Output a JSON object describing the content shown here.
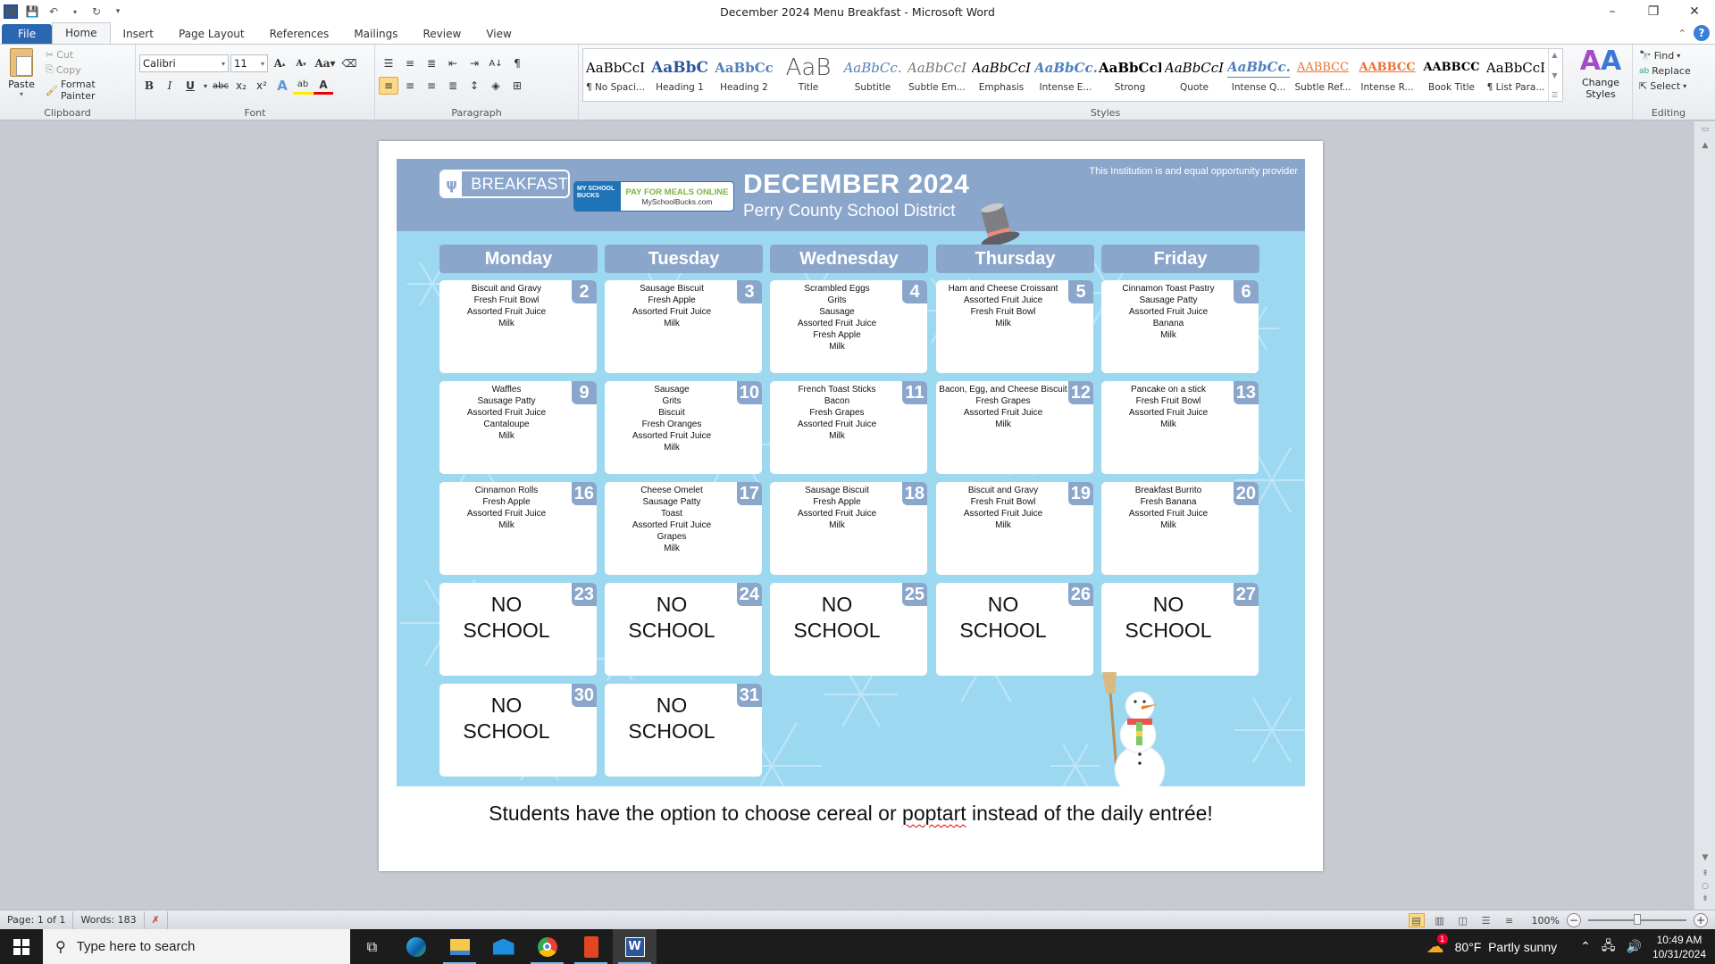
{
  "window": {
    "title": "December 2024 Menu Breakfast  -  Microsoft Word",
    "controls": {
      "minimize": "–",
      "restore": "❐",
      "close": "✕"
    }
  },
  "ribbon_tabs": [
    "File",
    "Home",
    "Insert",
    "Page Layout",
    "References",
    "Mailings",
    "Review",
    "View"
  ],
  "active_tab": "Home",
  "clipboard": {
    "paste": "Paste",
    "cut": "Cut",
    "copy": "Copy",
    "format_painter": "Format Painter",
    "label": "Clipboard"
  },
  "font": {
    "name": "Calibri",
    "size": "11",
    "label": "Font",
    "buttons": [
      "B",
      "I",
      "U",
      "abc",
      "x₂",
      "x²"
    ]
  },
  "paragraph": {
    "label": "Paragraph"
  },
  "styles": {
    "label": "Styles",
    "items": [
      {
        "preview": "AaBbCcI",
        "name": "¶ No Spaci..."
      },
      {
        "preview": "AaBbC",
        "name": "Heading 1"
      },
      {
        "preview": "AaBbCc",
        "name": "Heading 2"
      },
      {
        "preview": "AaB",
        "name": "Title"
      },
      {
        "preview": "AaBbCc.",
        "name": "Subtitle"
      },
      {
        "preview": "AaBbCcI",
        "name": "Subtle Em..."
      },
      {
        "preview": "AaBbCcI",
        "name": "Emphasis"
      },
      {
        "preview": "AaBbCc.",
        "name": "Intense E..."
      },
      {
        "preview": "AaBbCcI",
        "name": "Strong"
      },
      {
        "preview": "AaBbCcI",
        "name": "Quote"
      },
      {
        "preview": "AaBbCc.",
        "name": "Intense Q..."
      },
      {
        "preview": "AABBCC",
        "name": "Subtle Ref..."
      },
      {
        "preview": "AABBCC",
        "name": "Intense R..."
      },
      {
        "preview": "AABBCC",
        "name": "Book Title"
      },
      {
        "preview": "AaBbCcI",
        "name": "¶ List Para..."
      }
    ],
    "change_styles": "Change Styles"
  },
  "editing": {
    "find": "Find",
    "replace": "Replace",
    "select": "Select",
    "label": "Editing"
  },
  "flyer": {
    "badge": "BREAKFAST",
    "paybox": {
      "logo": "MY SCHOOL BUCKS",
      "line1": "PAY FOR MEALS ONLINE",
      "line2": "MySchoolBucks.com"
    },
    "title": "DECEMBER 2024",
    "district": "Perry County School District",
    "eop": "This Institution is and equal opportunity provider",
    "colors": {
      "header": "#8ba6cb",
      "background": "#9dd8f1"
    },
    "days": [
      "Monday",
      "Tuesday",
      "Wednesday",
      "Thursday",
      "Friday"
    ],
    "weeks": [
      [
        {
          "date": "2",
          "items": [
            "Biscuit and Gravy",
            "Fresh Fruit Bowl",
            "Assorted Fruit Juice",
            "Milk"
          ]
        },
        {
          "date": "3",
          "items": [
            "Sausage Biscuit",
            "Fresh Apple",
            "Assorted Fruit Juice",
            "Milk"
          ]
        },
        {
          "date": "4",
          "items": [
            "Scrambled Eggs",
            "Grits",
            "Sausage",
            "Assorted Fruit Juice",
            "Fresh Apple",
            "Milk"
          ]
        },
        {
          "date": "5",
          "items": [
            "Ham and Cheese Croissant",
            "Assorted Fruit Juice",
            "Fresh Fruit Bowl",
            "Milk"
          ]
        },
        {
          "date": "6",
          "items": [
            "Cinnamon Toast Pastry",
            "Sausage Patty",
            "Assorted Fruit Juice",
            "Banana",
            "Milk"
          ]
        }
      ],
      [
        {
          "date": "9",
          "items": [
            "Waffles",
            "Sausage Patty",
            "Assorted Fruit Juice",
            "Cantaloupe",
            "Milk"
          ]
        },
        {
          "date": "10",
          "items": [
            "Sausage",
            "Grits",
            "Biscuit",
            "Fresh Oranges",
            "Assorted Fruit Juice",
            "Milk"
          ]
        },
        {
          "date": "11",
          "items": [
            "French Toast Sticks",
            "Bacon",
            "Fresh Grapes",
            "Assorted Fruit Juice",
            "Milk"
          ]
        },
        {
          "date": "12",
          "items": [
            "Bacon, Egg, and Cheese Biscuit",
            "Fresh Grapes",
            "Assorted Fruit Juice",
            "Milk"
          ]
        },
        {
          "date": "13",
          "items": [
            "Pancake on a stick",
            "Fresh Fruit Bowl",
            "Assorted Fruit Juice",
            "Milk"
          ]
        }
      ],
      [
        {
          "date": "16",
          "items": [
            "Cinnamon Rolls",
            "Fresh Apple",
            "Assorted Fruit Juice",
            "Milk"
          ]
        },
        {
          "date": "17",
          "items": [
            "Cheese Omelet",
            "Sausage Patty",
            "Toast",
            "Assorted Fruit Juice",
            "Grapes",
            "Milk"
          ]
        },
        {
          "date": "18",
          "items": [
            "Sausage Biscuit",
            "Fresh Apple",
            "Assorted Fruit Juice",
            "Milk"
          ]
        },
        {
          "date": "19",
          "items": [
            "Biscuit and Gravy",
            "Fresh Fruit Bowl",
            "Assorted Fruit Juice",
            "Milk"
          ]
        },
        {
          "date": "20",
          "items": [
            "Breakfast Burrito",
            "Fresh Banana",
            "Assorted Fruit Juice",
            "Milk"
          ]
        }
      ],
      [
        {
          "date": "23",
          "no_school": [
            "NO",
            "SCHOOL"
          ]
        },
        {
          "date": "24",
          "no_school": [
            "NO",
            "SCHOOL"
          ]
        },
        {
          "date": "25",
          "no_school": [
            "NO",
            "SCHOOL"
          ]
        },
        {
          "date": "26",
          "no_school": [
            "NO",
            "SCHOOL"
          ]
        },
        {
          "date": "27",
          "no_school": [
            "NO",
            "SCHOOL"
          ]
        }
      ],
      [
        {
          "date": "30",
          "no_school": [
            "NO",
            "SCHOOL"
          ]
        },
        {
          "date": "31",
          "no_school": [
            "NO",
            "SCHOOL"
          ]
        }
      ]
    ],
    "footnote_before": "Students have the option to choose cereal or ",
    "footnote_misspelled": "poptart",
    "footnote_after": " instead of the daily entrée!"
  },
  "statusbar": {
    "page": "Page: 1 of 1",
    "words": "Words: 183",
    "zoom": "100%",
    "zoom_percent": 100
  },
  "taskbar": {
    "search_placeholder": "Type here to search",
    "apps": [
      "task-view",
      "edge",
      "file-explorer",
      "mail",
      "chrome",
      "office",
      "word"
    ],
    "weather": "80°F  Partly sunny",
    "weather_badge": "1",
    "time": "10:49 AM",
    "date": "10/31/2024"
  }
}
